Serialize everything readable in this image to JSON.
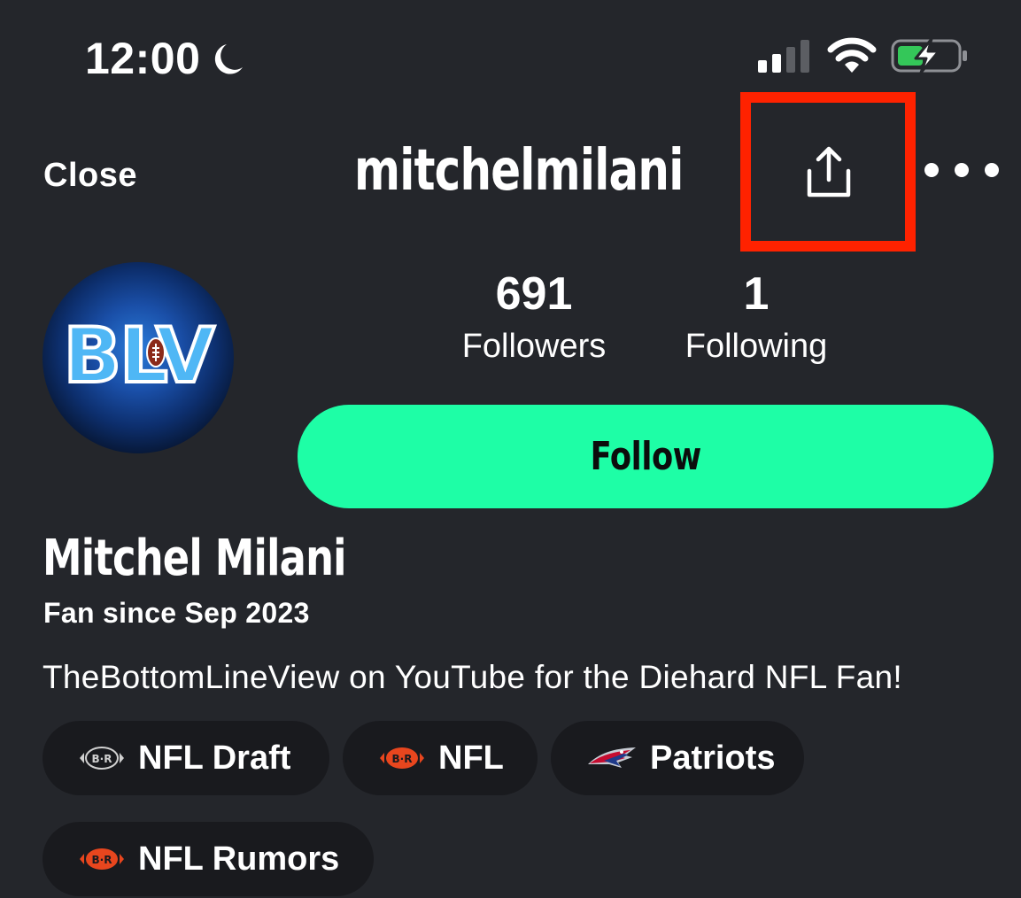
{
  "status_bar": {
    "time": "12:00",
    "icons": [
      "moon-icon",
      "cellular-signal-icon",
      "wifi-icon",
      "battery-charging-icon"
    ],
    "battery_color": "#34c759"
  },
  "header": {
    "close_label": "Close",
    "username": "mitchelmilani",
    "share_icon": "share-icon",
    "more_icon": "more-options-icon",
    "highlight_color": "#ff2200"
  },
  "profile": {
    "avatar_text": "BLV",
    "stats": [
      {
        "value": "691",
        "label": "Followers"
      },
      {
        "value": "1",
        "label": "Following"
      }
    ],
    "follow_label": "Follow",
    "follow_color": "#1efea6",
    "full_name": "Mitchel Milani",
    "fan_since": "Fan since Sep 2023",
    "bio": "TheBottomLineView on YouTube for the Diehard NFL Fan!"
  },
  "chips": [
    {
      "label": "NFL Draft",
      "icon": "br-football-outline-icon"
    },
    {
      "label": "NFL",
      "icon": "br-football-icon"
    },
    {
      "label": "Patriots",
      "icon": "patriots-logo-icon"
    },
    {
      "label": "NFL Rumors",
      "icon": "br-football-icon"
    }
  ],
  "colors": {
    "background": "#24262b",
    "chip_background": "#191a1e",
    "br_orange": "#e8461e"
  }
}
